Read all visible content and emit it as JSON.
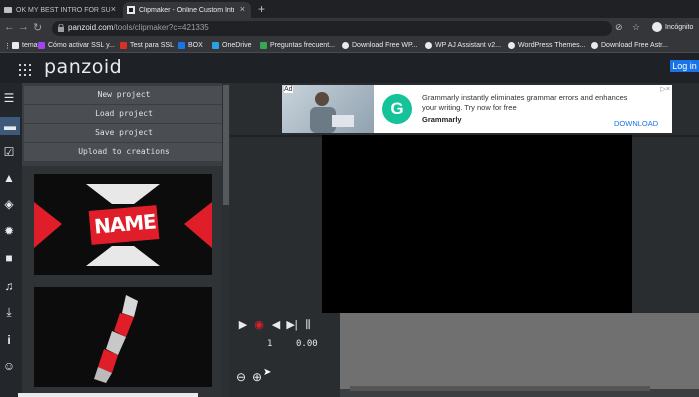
{
  "tabs": [
    {
      "title": "OK MY BEST INTRO FOR SURE C",
      "active": false
    },
    {
      "title": "Clipmaker - Online Custom Intro",
      "active": true
    }
  ],
  "address": {
    "host": "panzoid.com",
    "path": "/tools/clipmaker?c=421335",
    "profile_label": "Incógnito"
  },
  "bookmarks": [
    {
      "label": "temas",
      "color": "#e8eaed"
    },
    {
      "label": "Cómo activar SSL y...",
      "color": "#a142f4"
    },
    {
      "label": "Test para SSL",
      "color": "#d93025"
    },
    {
      "label": "BOX",
      "color": "#1a73e8"
    },
    {
      "label": "OneDrive",
      "color": "#2aa1e4"
    },
    {
      "label": "Preguntas frecuent...",
      "color": "#34a853"
    },
    {
      "label": "Download Free WP...",
      "color": "#e8eaed"
    },
    {
      "label": "WP AJ Assistant v2...",
      "color": "#e8eaed"
    },
    {
      "label": "WordPress Themes...",
      "color": "#e8eaed"
    },
    {
      "label": "Download Free Astr...",
      "color": "#e8eaed"
    }
  ],
  "header": {
    "logo": "panzoid",
    "login": "Log in"
  },
  "rail": [
    {
      "icon": "menu-icon",
      "glyph": "☰"
    },
    {
      "icon": "folder-icon",
      "glyph": "▬",
      "active": true
    },
    {
      "icon": "checkbox-icon",
      "glyph": "☑"
    },
    {
      "icon": "image-icon",
      "glyph": "▲"
    },
    {
      "icon": "cube-icon",
      "glyph": "◈"
    },
    {
      "icon": "burst-icon",
      "glyph": "✹"
    },
    {
      "icon": "camera-icon",
      "glyph": "■"
    },
    {
      "icon": "music-icon",
      "glyph": "♫"
    },
    {
      "icon": "download-icon",
      "glyph": "⤓"
    },
    {
      "icon": "info-icon",
      "glyph": "i"
    },
    {
      "icon": "smiley-icon",
      "glyph": "☺"
    }
  ],
  "panel": {
    "new_project": "New project",
    "load_project": "Load project",
    "save_project": "Save project",
    "upload": "Upload to creations"
  },
  "thumb1": {
    "text": "NAME"
  },
  "ad": {
    "tag": "Ad",
    "text": "Grammarly instantly eliminates grammar errors and enhances your writing. Try now for free",
    "brand": "Grammarly",
    "cta": "DOWNLOAD",
    "logo_letter": "G"
  },
  "player": {
    "frame": "1",
    "time": "0.00"
  },
  "colors": {
    "accent": "#1a73e8",
    "thumb_red": "#e01e2a",
    "active_rail": "#3d5a7a"
  }
}
